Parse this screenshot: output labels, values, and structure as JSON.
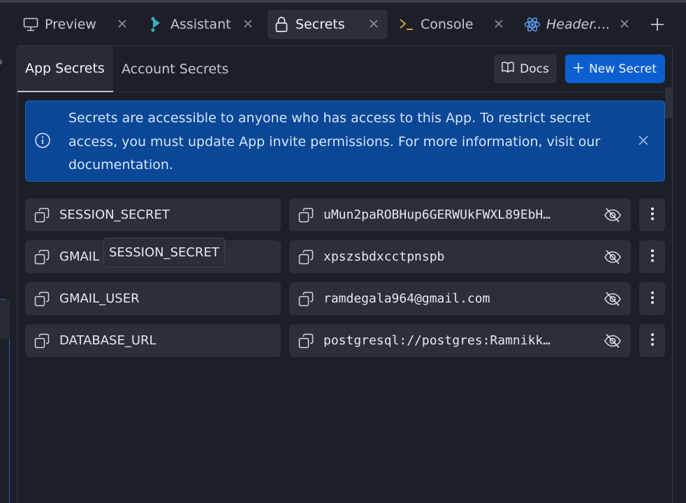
{
  "tabs": [
    {
      "label": "Preview",
      "icon": "monitor-icon",
      "active": false
    },
    {
      "label": "Assistant",
      "icon": "assistant-icon",
      "active": false
    },
    {
      "label": "Secrets",
      "icon": "lock-icon",
      "active": true
    },
    {
      "label": "Console",
      "icon": "terminal-icon",
      "active": false
    },
    {
      "label": "Header....",
      "icon": "react-icon",
      "active": false
    }
  ],
  "subtabs": {
    "app": "App Secrets",
    "account": "Account Secrets"
  },
  "actions": {
    "docs": "Docs",
    "new_secret": "New Secret"
  },
  "banner": {
    "text": "Secrets are accessible to anyone who has access to this App. To restrict secret access, you must update App invite permissions. For more information, visit our documentation."
  },
  "secrets": [
    {
      "key": "SESSION_SECRET",
      "value": "uMun2paROBHup6GERWUkFWXL89EbH…"
    },
    {
      "key": "GMAIL",
      "value": "xpszsbdxcctpnspb"
    },
    {
      "key": "GMAIL_USER",
      "value": "ramdegala964@gmail.com"
    },
    {
      "key": "DATABASE_URL",
      "value": "postgresql://postgres:Ramnikk…"
    }
  ],
  "tooltip": "SESSION_SECRET",
  "colors": {
    "background": "#1c1f27",
    "row": "#2b2f38",
    "banner": "#0a4796",
    "primary_button": "#0b5fd0",
    "console_prompt": "#e3b341",
    "assistant_icon": "#3fa8c2",
    "react_icon": "#5b9cf0"
  }
}
